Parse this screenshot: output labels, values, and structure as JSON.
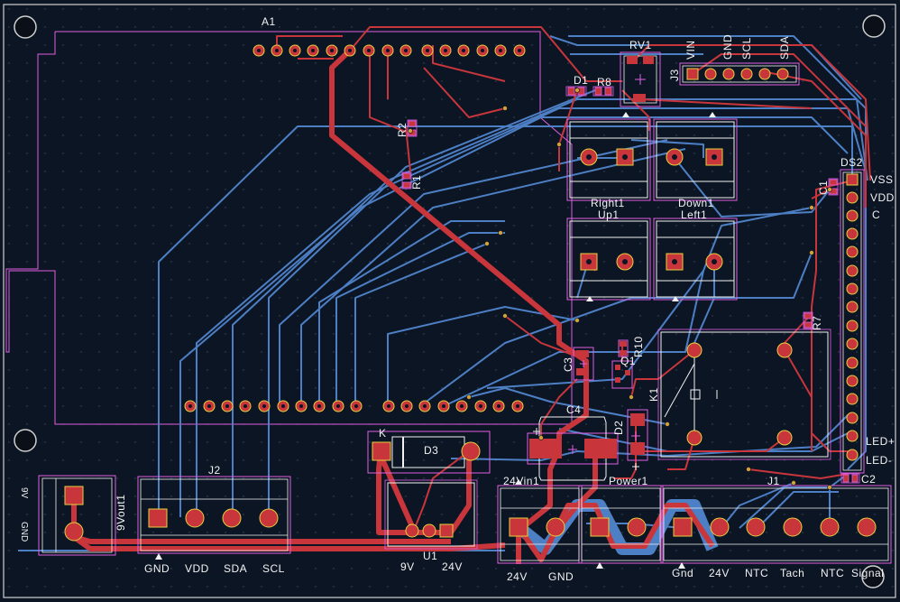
{
  "colors": {
    "background": "#0c1524",
    "front_copper": "#c8363c",
    "back_copper": "#4d7fc4",
    "courtyard": "#e060e0",
    "silkscreen": "#f2f2f2",
    "pad": "#c8363c",
    "pad_outline": "#e6d040",
    "board_edge": "#d0d0d0"
  },
  "components": {
    "a1": "A1",
    "rv1": "RV1",
    "d1": "D1",
    "r8": "R8",
    "j3": "J3",
    "r2": "R2",
    "r1": "R1",
    "ds2": "DS2",
    "c1": "C1",
    "right1": "Right1",
    "down1": "Down1",
    "up1": "Up1",
    "left1": "Left1",
    "r7": "R7",
    "r10": "R10",
    "c3": "C3",
    "q1": "Q1",
    "k1": "K1",
    "d2": "D2",
    "c4": "C4",
    "d3": "D3",
    "k_mark": "K",
    "j2": "J2",
    "u1": "U1",
    "vout": "9Vout1",
    "vin": "24Vin1",
    "power1": "Power1",
    "j1": "J1",
    "c2": "C2"
  },
  "j3_pins": [
    "VIN",
    "GND",
    "SCL",
    "SDA"
  ],
  "ds2_pins": [
    "VSS",
    "VDD",
    "C",
    "LED+",
    "LED-"
  ],
  "j2_pins": [
    "GND",
    "VDD",
    "SDA",
    "SCL"
  ],
  "u1_pins": [
    "9V",
    "24V"
  ],
  "power_pins": [
    "24V",
    "GND"
  ],
  "j1_pins": [
    "Gnd",
    "24V",
    "NTC",
    "Tach",
    "NTC",
    "Signal"
  ],
  "vout_pins": [
    "9V",
    "GND"
  ]
}
